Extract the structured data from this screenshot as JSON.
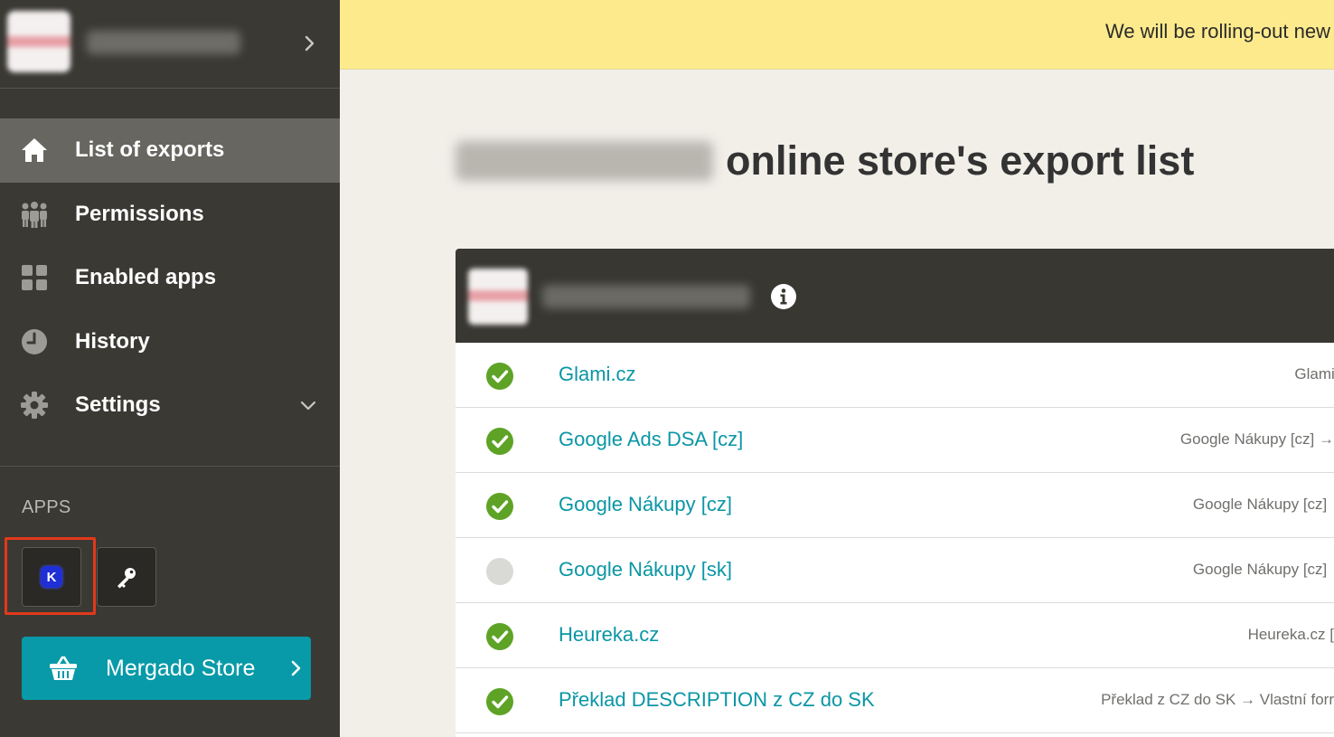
{
  "banner": {
    "text": "We will be rolling-out new"
  },
  "sidebar": {
    "nav": [
      {
        "label": "List of exports",
        "icon": "home-icon",
        "active": true
      },
      {
        "label": "Permissions",
        "icon": "users-icon"
      },
      {
        "label": "Enabled apps",
        "icon": "grid-icon"
      },
      {
        "label": "History",
        "icon": "clock-icon"
      },
      {
        "label": "Settings",
        "icon": "gear-icon",
        "expandable": true
      }
    ],
    "apps_label": "APPS",
    "apps": [
      {
        "icon": "k-app-icon",
        "badge": "K"
      },
      {
        "icon": "key-icon"
      }
    ],
    "store_button": "Mergado Store"
  },
  "main": {
    "title": "online store's export list",
    "exports": [
      {
        "name": "Glami.cz",
        "status": "enabled",
        "source": "Glami.c"
      },
      {
        "name": "Google Ads DSA [cz]",
        "status": "enabled",
        "source": "Google Nákupy [cz] →"
      },
      {
        "name": "Google Nákupy [cz]",
        "status": "enabled",
        "source": "Google Nákupy [cz] →"
      },
      {
        "name": "Google Nákupy [sk]",
        "status": "disabled",
        "source": "Google Nákupy [cz] →"
      },
      {
        "name": "Heureka.cz",
        "status": "enabled",
        "source": "Heureka.cz ["
      },
      {
        "name": "Překlad DESCRIPTION z CZ do SK",
        "status": "enabled",
        "source": "Překlad z CZ do SK → Vlastní forr"
      }
    ]
  },
  "colors": {
    "sidebar_bg": "#3a3934",
    "active_item": "#676661",
    "accent": "#089aa8",
    "banner": "#fdea8d",
    "status_ok": "#5ea326",
    "status_off": "#d9d9d6",
    "highlight": "#e2391a"
  }
}
